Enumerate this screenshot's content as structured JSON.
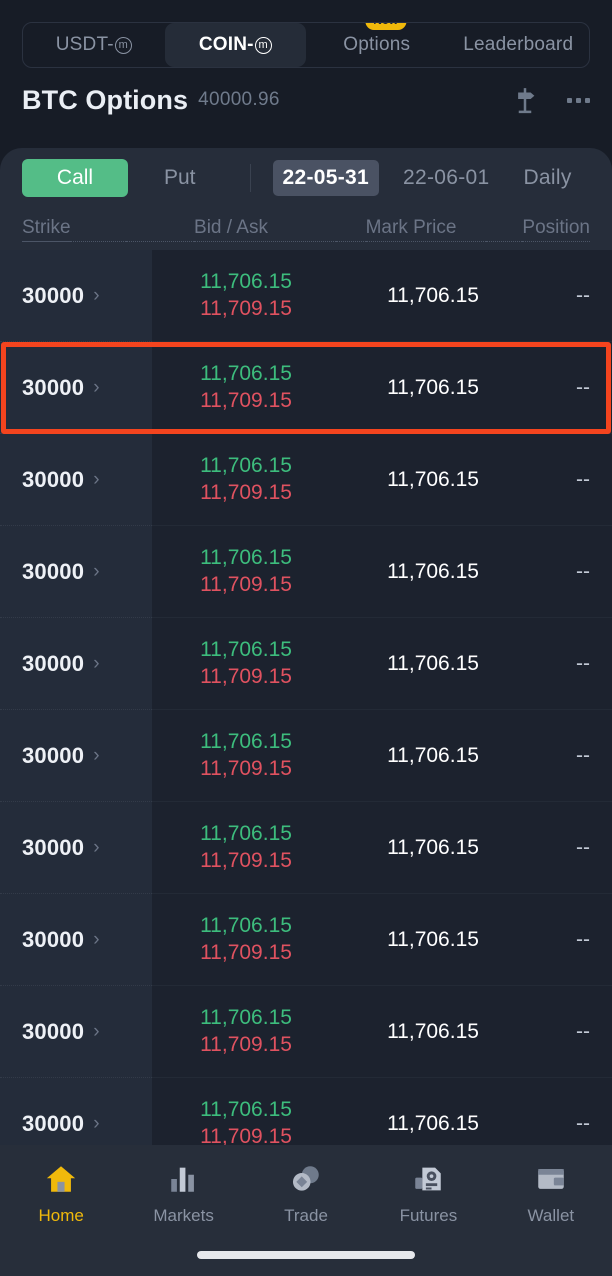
{
  "product_tabs": [
    {
      "label": "USDT-",
      "symbol": "m",
      "active": false,
      "badge": null
    },
    {
      "label": "COIN-",
      "symbol": "m",
      "active": true,
      "badge": null
    },
    {
      "label": "Options",
      "symbol": null,
      "active": false,
      "badge": "New"
    },
    {
      "label": "Leaderboard",
      "symbol": null,
      "active": false,
      "badge": null
    }
  ],
  "header": {
    "title": "BTC Options",
    "price": "40000.96",
    "signpost_icon": "signpost-icon",
    "more_icon": "more-icon"
  },
  "filters": {
    "call_label": "Call",
    "put_label": "Put",
    "dates": [
      {
        "label": "22-05-31",
        "active": true
      },
      {
        "label": "22-06-01",
        "active": false
      },
      {
        "label": "Daily",
        "active": false
      }
    ]
  },
  "columns": {
    "strike": "Strike",
    "bid_ask": "Bid / Ask",
    "mark_price": "Mark Price",
    "position": "Position"
  },
  "rows": [
    {
      "strike": "30000",
      "bid": "11,706.15",
      "ask": "11,709.15",
      "mark": "11,706.15",
      "position": "--",
      "highlighted": false
    },
    {
      "strike": "30000",
      "bid": "11,706.15",
      "ask": "11,709.15",
      "mark": "11,706.15",
      "position": "--",
      "highlighted": true
    },
    {
      "strike": "30000",
      "bid": "11,706.15",
      "ask": "11,709.15",
      "mark": "11,706.15",
      "position": "--",
      "highlighted": false
    },
    {
      "strike": "30000",
      "bid": "11,706.15",
      "ask": "11,709.15",
      "mark": "11,706.15",
      "position": "--",
      "highlighted": false
    },
    {
      "strike": "30000",
      "bid": "11,706.15",
      "ask": "11,709.15",
      "mark": "11,706.15",
      "position": "--",
      "highlighted": false
    },
    {
      "strike": "30000",
      "bid": "11,706.15",
      "ask": "11,709.15",
      "mark": "11,706.15",
      "position": "--",
      "highlighted": false
    },
    {
      "strike": "30000",
      "bid": "11,706.15",
      "ask": "11,709.15",
      "mark": "11,706.15",
      "position": "--",
      "highlighted": false
    },
    {
      "strike": "30000",
      "bid": "11,706.15",
      "ask": "11,709.15",
      "mark": "11,706.15",
      "position": "--",
      "highlighted": false
    },
    {
      "strike": "30000",
      "bid": "11,706.15",
      "ask": "11,709.15",
      "mark": "11,706.15",
      "position": "--",
      "highlighted": false
    },
    {
      "strike": "30000",
      "bid": "11,706.15",
      "ask": "11,709.15",
      "mark": "11,706.15",
      "position": "--",
      "highlighted": false
    }
  ],
  "chevron": "›",
  "bottom_nav": [
    {
      "label": "Home",
      "icon": "home-icon",
      "active": true
    },
    {
      "label": "Markets",
      "icon": "markets-icon",
      "active": false
    },
    {
      "label": "Trade",
      "icon": "trade-icon",
      "active": false
    },
    {
      "label": "Futures",
      "icon": "futures-icon",
      "active": false
    },
    {
      "label": "Wallet",
      "icon": "wallet-icon",
      "active": false
    }
  ],
  "colors": {
    "page_bg": "#171c26",
    "panel_bg": "#262d3a",
    "table_bg": "#1c222e",
    "strike_col_bg": "#242c3a",
    "call_green": "#54bd87",
    "bid_green": "#3dbd7d",
    "ask_red": "#e05260",
    "highlight_red": "#f4441e",
    "accent_yellow": "#f0b90b",
    "nav_bg": "#272e3a"
  }
}
